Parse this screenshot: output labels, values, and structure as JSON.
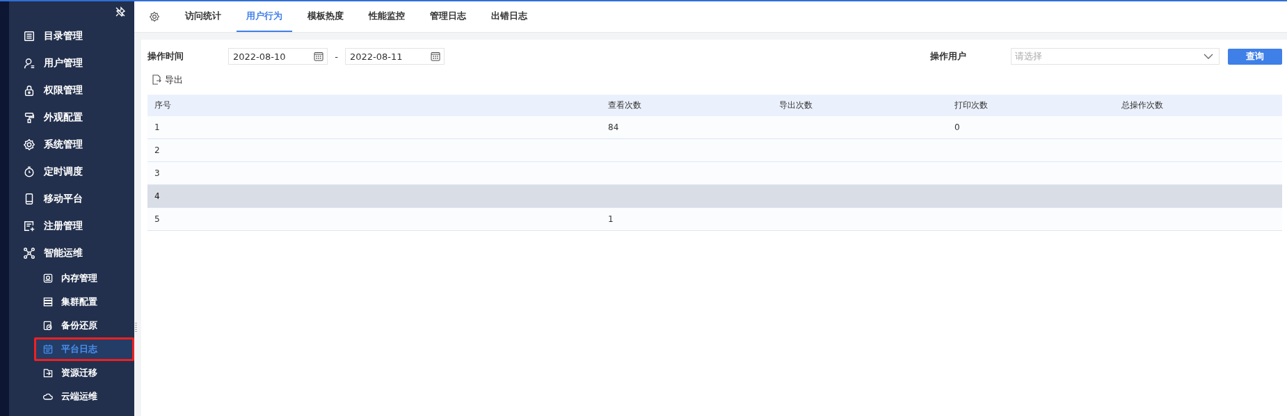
{
  "sidebar": {
    "items": [
      {
        "label": "目录管理",
        "selected": false
      },
      {
        "label": "用户管理",
        "selected": false
      },
      {
        "label": "权限管理",
        "selected": false
      },
      {
        "label": "外观配置",
        "selected": false
      },
      {
        "label": "系统管理",
        "selected": false
      },
      {
        "label": "定时调度",
        "selected": false
      },
      {
        "label": "移动平台",
        "selected": false
      },
      {
        "label": "注册管理",
        "selected": false
      },
      {
        "label": "智能运维",
        "selected": false,
        "children": [
          {
            "label": "内存管理",
            "selected": false
          },
          {
            "label": "集群配置",
            "selected": false
          },
          {
            "label": "备份还原",
            "selected": false
          },
          {
            "label": "平台日志",
            "selected": true
          },
          {
            "label": "资源迁移",
            "selected": false
          },
          {
            "label": "云端运维",
            "selected": false
          }
        ]
      }
    ]
  },
  "tabs": [
    {
      "label": "访问统计",
      "selected": false
    },
    {
      "label": "用户行为",
      "selected": true
    },
    {
      "label": "模板热度",
      "selected": false
    },
    {
      "label": "性能监控",
      "selected": false
    },
    {
      "label": "管理日志",
      "selected": false
    },
    {
      "label": "出错日志",
      "selected": false
    }
  ],
  "filters": {
    "time_label": "操作时间",
    "date_from": "2022-08-10",
    "separator": "-",
    "date_to": "2022-08-11",
    "user_label": "操作用户",
    "user_placeholder": "请选择",
    "query_button": "查询"
  },
  "export_button": "导出",
  "table": {
    "columns": [
      "序号",
      "查看次数",
      "导出次数",
      "打印次数",
      "总操作次数"
    ],
    "rows": [
      {
        "cells": [
          "1",
          "84",
          "",
          "0",
          ""
        ],
        "hovered": false
      },
      {
        "cells": [
          "2",
          "",
          "",
          "",
          ""
        ],
        "hovered": false
      },
      {
        "cells": [
          "3",
          "",
          "",
          "",
          ""
        ],
        "hovered": false
      },
      {
        "cells": [
          "4",
          "",
          "",
          "",
          ""
        ],
        "hovered": true
      },
      {
        "cells": [
          "5",
          "1",
          "",
          "",
          ""
        ],
        "hovered": false
      }
    ]
  }
}
